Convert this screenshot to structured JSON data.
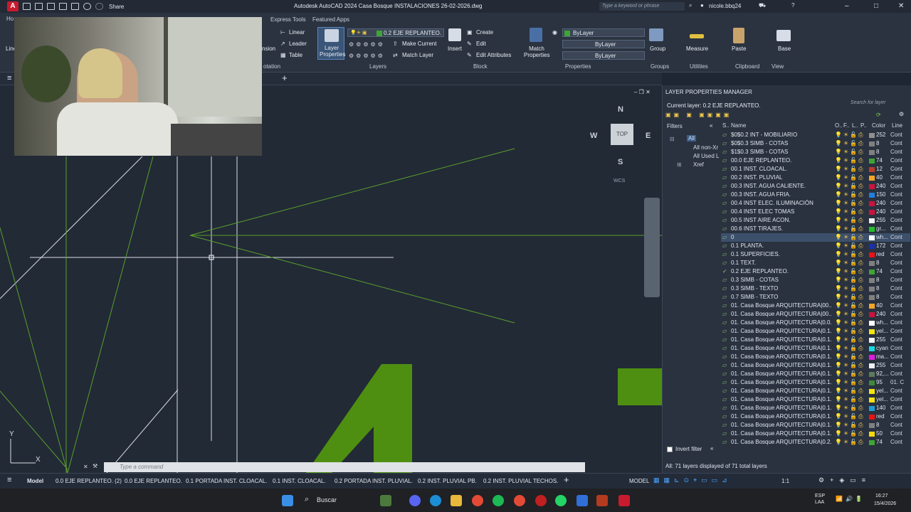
{
  "titlebar": {
    "app_letter": "A",
    "share_label": "Share",
    "title": "Autodesk AutoCAD 2024   Casa Bosque INSTALACIONES 26-02-2026.dwg",
    "search_placeholder": "Type a keyword or phrase",
    "user": "nicole.bbq24"
  },
  "ribbon": {
    "tabs": [
      "Ho",
      "Express Tools",
      "Featured Apps"
    ],
    "annotation": {
      "linear": "Linear",
      "leader": "Leader",
      "table": "Table",
      "dimension": "nsion",
      "panel": "otation"
    },
    "layers": {
      "layer_properties": "Layer Properties",
      "current_layer": "0.2 EJE REPLANTEO.",
      "make_current": "Make Current",
      "match_layer": "Match Layer",
      "panel": "Layers"
    },
    "block": {
      "insert": "Insert",
      "create": "Create",
      "edit": "Edit",
      "edit_attributes": "Edit Attributes",
      "panel": "Block"
    },
    "properties": {
      "match": "Match Properties",
      "color": "ByLayer",
      "linetype": "ByLayer",
      "lineweight": "ByLayer",
      "panel": "Properties"
    },
    "groups": {
      "group": "Group",
      "panel": "Groups"
    },
    "utilities": {
      "measure": "Measure",
      "panel": "Utilities"
    },
    "clipboard": {
      "paste": "Paste",
      "panel": "Clipboard"
    },
    "view": {
      "base": "Base",
      "panel": "View"
    },
    "left_cut": "Line"
  },
  "viewcube": {
    "top": "TOP",
    "n": "N",
    "s": "S",
    "e": "E",
    "w": "W",
    "wcs": "WCS"
  },
  "command_line": {
    "placeholder": "Type a command"
  },
  "ucs": {
    "x": "X",
    "y": "Y"
  },
  "lpm": {
    "title": "LAYER PROPERTIES MANAGER",
    "current": "Current layer: 0.2 EJE REPLANTEO.",
    "search_placeholder": "Search for layer",
    "filters_label": "Filters",
    "tree": [
      "All",
      "All non-Xr",
      "All Used L",
      "Xref"
    ],
    "headers": {
      "s": "S..",
      "name": "Name",
      "o": "O..",
      "f": "F..",
      "l": "L..",
      "p": "P..",
      "color": "Color",
      "linetype": "Line"
    },
    "invert_filter": "Invert filter",
    "status": "All: 71 layers displayed of 71 total layers",
    "layers": [
      {
        "name": "$0$0.2 INT - MOBILIARIO",
        "color": "252",
        "hex": "#8e8e8e"
      },
      {
        "name": "$0$0.3 SIMB - COTAS",
        "color": "8",
        "hex": "#808080"
      },
      {
        "name": "$1$0.3 SIMB - COTAS",
        "color": "8",
        "hex": "#808080"
      },
      {
        "name": "00.0 EJE REPLANTEO.",
        "color": "74",
        "hex": "#3fa535"
      },
      {
        "name": "00.1 INST. CLOACAL.",
        "color": "12",
        "hex": "#c0392b"
      },
      {
        "name": "00.2 INST. PLUVIAL",
        "color": "40",
        "hex": "#f5a623"
      },
      {
        "name": "00.3 INST. AGUA CALIENTE.",
        "color": "240",
        "hex": "#d0113b"
      },
      {
        "name": "00.3 INST. AGUA FRIA.",
        "color": "150",
        "hex": "#1f7fe0"
      },
      {
        "name": "00.4 INST ELEC. ILUMINACIÓN",
        "color": "240",
        "hex": "#d0113b"
      },
      {
        "name": "00.4 INST ELEC TOMAS",
        "color": "240",
        "hex": "#d0113b"
      },
      {
        "name": "00.5 INST AIRE ACON.",
        "color": "255",
        "hex": "#f0f0f0"
      },
      {
        "name": "00.6 INST TIRAJES.",
        "color": "gr...",
        "hex": "#22c02a"
      },
      {
        "name": "0",
        "color": "wh...",
        "hex": "#ffffff",
        "selected": true
      },
      {
        "name": "0.1 PLANTA.",
        "color": "172",
        "hex": "#1a2fb0"
      },
      {
        "name": "0.1 SUPERFICIES.",
        "color": "red",
        "hex": "#ee1111"
      },
      {
        "name": "0.1 TEXT.",
        "color": "8",
        "hex": "#808080"
      },
      {
        "name": "0.2 EJE REPLANTEO.",
        "color": "74",
        "hex": "#3fa535",
        "current": true
      },
      {
        "name": "0.3 SIMB - COTAS",
        "color": "8",
        "hex": "#808080"
      },
      {
        "name": "0.3 SIMB - TEXTO",
        "color": "8",
        "hex": "#808080"
      },
      {
        "name": "0.7 SIMB - TEXTO",
        "color": "8",
        "hex": "#808080"
      },
      {
        "name": "01. Casa Bosque ARQUITECTURA|00...",
        "color": "40",
        "hex": "#f5a623"
      },
      {
        "name": "01. Casa Bosque ARQUITECTURA|00...",
        "color": "240",
        "hex": "#d0113b"
      },
      {
        "name": "01. Casa Bosque ARQUITECTURA|0.0...",
        "color": "wh...",
        "hex": "#ffffff"
      },
      {
        "name": "01. Casa Bosque ARQUITECTURA|0.1...",
        "color": "yel...",
        "hex": "#f5e50c"
      },
      {
        "name": "01. Casa Bosque ARQUITECTURA|0.1...",
        "color": "255",
        "hex": "#f0f0f0"
      },
      {
        "name": "01. Casa Bosque ARQUITECTURA|0.1...",
        "color": "cyan",
        "hex": "#16d9e3"
      },
      {
        "name": "01. Casa Bosque ARQUITECTURA|0.1...",
        "color": "ma...",
        "hex": "#e01be0"
      },
      {
        "name": "01. Casa Bosque ARQUITECTURA|0.1...",
        "color": "255",
        "hex": "#f0f0f0"
      },
      {
        "name": "01. Casa Bosque ARQUITECTURA|0.1...",
        "color": "92,...",
        "hex": "#5c7a5c"
      },
      {
        "name": "01. Casa Bosque ARQUITECTURA|0.1...",
        "color": "95",
        "hex": "#3f8a3a"
      },
      {
        "name": "01. Casa Bosque ARQUITECTURA|0.1...",
        "color": "yel...",
        "hex": "#f5e50c"
      },
      {
        "name": "01. Casa Bosque ARQUITECTURA|0.1...",
        "color": "yel...",
        "hex": "#f5e50c"
      },
      {
        "name": "01. Casa Bosque ARQUITECTURA|0.1...",
        "color": "140",
        "hex": "#1c9ed6"
      },
      {
        "name": "01. Casa Bosque ARQUITECTURA|0.1...",
        "color": "red",
        "hex": "#ee1111"
      },
      {
        "name": "01. Casa Bosque ARQUITECTURA|0.1...",
        "color": "8",
        "hex": "#808080"
      },
      {
        "name": "01. Casa Bosque ARQUITECTURA|0.1...",
        "color": "50",
        "hex": "#f5d90a"
      },
      {
        "name": "01. Casa Bosque ARQUITECTURA|0.2...",
        "color": "74",
        "hex": "#3fa535"
      }
    ],
    "linetype_short": "Cont",
    "linetype_alt": "01. C"
  },
  "layout_tabs": [
    "Model",
    "0.0 EJE REPLANTEO. (2)",
    "0.0 EJE REPLANTEO.",
    "0.1 PORTADA INST. CLOACAL.",
    "0.1 INST. CLOACAL.",
    "0.2 PORTADA INST. PLUVIAL.",
    "0.2 INST. PLUVIAL PB.",
    "0.2 INST. PLUVIAL TECHOS."
  ],
  "status": {
    "model": "MODEL",
    "scale": "1:1"
  },
  "taskbar": {
    "search": "Buscar",
    "lang": "ESP\nLAA",
    "time": "16:27",
    "date": "15/4/2026"
  }
}
